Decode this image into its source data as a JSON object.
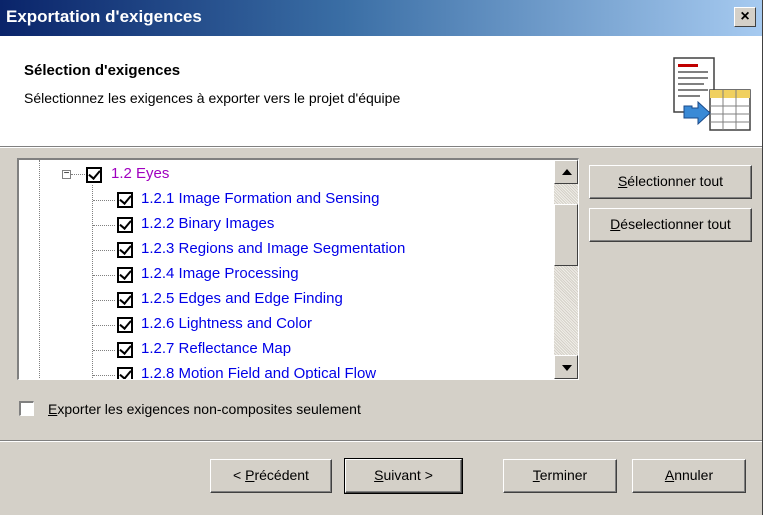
{
  "window": {
    "title": "Exportation d'exigences",
    "close_glyph": "×"
  },
  "header": {
    "title": "Sélection d'exigences",
    "subtitle": "Sélectionnez les exigences à exporter vers le projet d'équipe",
    "icon": "export-requirements-icon"
  },
  "tree": {
    "parent": {
      "expander": "−",
      "checked": true,
      "label": "1.2 Eyes"
    },
    "children": [
      {
        "label": "1.2.1 Image Formation and Sensing",
        "checked": true
      },
      {
        "label": "1.2.2 Binary Images",
        "checked": true
      },
      {
        "label": "1.2.3 Regions and Image Segmentation",
        "checked": true
      },
      {
        "label": "1.2.4 Image Processing",
        "checked": true
      },
      {
        "label": "1.2.5 Edges and Edge Finding",
        "checked": true
      },
      {
        "label": "1.2.6 Lightness and Color",
        "checked": true
      },
      {
        "label": "1.2.7 Reflectance Map",
        "checked": true
      },
      {
        "label": "1.2.8 Motion Field and Optical Flow",
        "checked": true
      }
    ]
  },
  "side_buttons": {
    "select_all": {
      "accel": "S",
      "rest": "électionner tout"
    },
    "deselect_all": {
      "accel": "D",
      "rest": "éselectionner tout"
    }
  },
  "option": {
    "checked": false,
    "accel": "E",
    "rest": "xporter les exigences non-composites seulement"
  },
  "footer": {
    "previous": {
      "pre": "< ",
      "accel": "P",
      "rest": "récédent"
    },
    "next": {
      "accel": "S",
      "rest": "uivant >"
    },
    "finish": {
      "accel": "T",
      "rest": "erminer"
    },
    "cancel": {
      "accel": "A",
      "rest": "nnuler"
    }
  },
  "colors": {
    "parent_label": "#a000c0",
    "child_label": "#0000e8",
    "titlebar_start": "#0a246a",
    "titlebar_end": "#a6caf0"
  }
}
